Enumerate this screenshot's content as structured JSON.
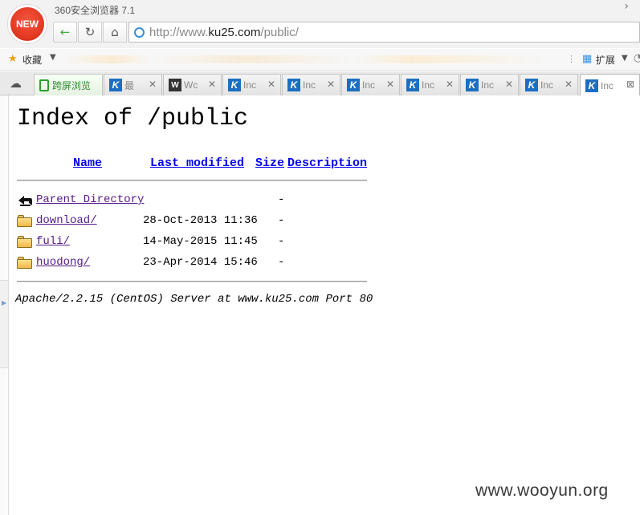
{
  "window": {
    "logo_text": "NEW",
    "app_title": "360安全浏览器 7.1"
  },
  "address": {
    "url_prefix": "http://www.",
    "url_host": "ku25.com",
    "url_path": "/public/"
  },
  "bookmarks": {
    "favorites_label": "收藏",
    "extensions_label": "扩展"
  },
  "tabs": [
    {
      "label": "跨屏浏览",
      "type": "special"
    },
    {
      "label": "最",
      "favicon": "K"
    },
    {
      "label": "Wc",
      "favicon": "W"
    },
    {
      "label": "Inc",
      "favicon": "K"
    },
    {
      "label": "Inc",
      "favicon": "K"
    },
    {
      "label": "Inc",
      "favicon": "K"
    },
    {
      "label": "Inc",
      "favicon": "K"
    },
    {
      "label": "Inc",
      "favicon": "K"
    },
    {
      "label": "Inc",
      "favicon": "K"
    },
    {
      "label": "Inc",
      "favicon": "K",
      "active": true
    }
  ],
  "listing": {
    "title": "Index of /public",
    "columns": [
      "Name",
      "Last modified",
      "Size",
      "Description"
    ],
    "rows": [
      {
        "name": "Parent Directory",
        "modified": "",
        "size": "-",
        "icon": "back-arrow-icon"
      },
      {
        "name": "download/",
        "modified": "28-Oct-2013 11:36",
        "size": "-",
        "icon": "folder-icon"
      },
      {
        "name": "fuli/",
        "modified": "14-May-2015 11:45",
        "size": "-",
        "icon": "folder-icon"
      },
      {
        "name": "huodong/",
        "modified": "23-Apr-2014 15:46",
        "size": "-",
        "icon": "folder-icon"
      }
    ],
    "server_signature": "Apache/2.2.15 (CentOS) Server at www.ku25.com Port 80"
  },
  "watermark": "www.wooyun.org",
  "colors": {
    "link_unvisited": "#0000ee",
    "link_visited": "#551a8b",
    "logo_red": "#e53a24",
    "accent_green": "#2e8b2e"
  }
}
